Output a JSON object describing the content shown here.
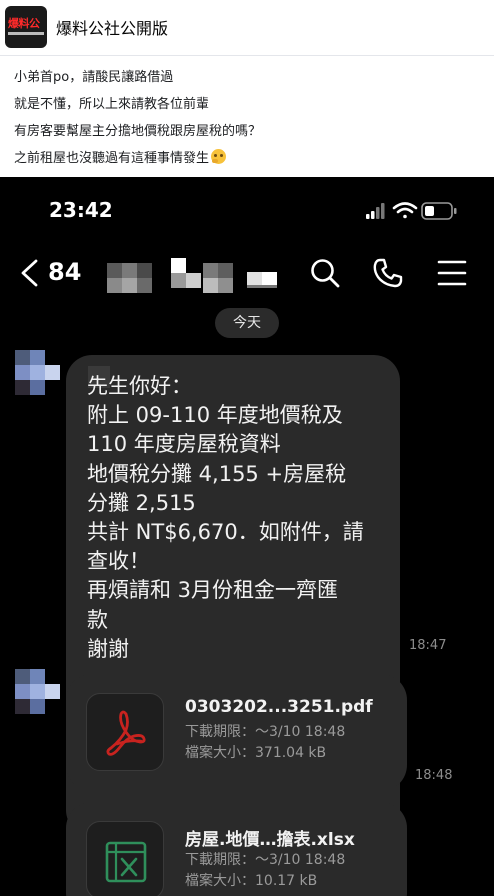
{
  "post": {
    "page_name": "爆料公社公開版",
    "avatar_text": "爆料公",
    "lines": [
      "小弟首po，請酸民讓路借過",
      "就是不懂，所以上來請教各位前輩",
      "有房客要幫屋主分擔地價稅跟房屋稅的嗎？",
      "之前租屋也沒聽過有這種事情發生"
    ]
  },
  "phone": {
    "status_time": "23:42",
    "nav": {
      "back_count": "84"
    },
    "date_chip": "今天",
    "messages": [
      {
        "text": "先生你好：\n附上 09-110 年度地價稅及\n110 年度房屋稅資料\n地價稅分攤 4,155 +房屋稅\n分攤 2,515\n共計 NT$6,670．如附件，請\n查收！\n再煩請和 3月份租金一齊匯\n款\n謝謝",
        "time": "18:47"
      }
    ],
    "files": [
      {
        "name": "0303202...3251.pdf",
        "expiry": "下載期限：～3/10 18:48",
        "size": "檔案大小：371.04 kB",
        "time": "18:48",
        "icon": "pdf-icon"
      },
      {
        "name": "房屋.地價…擔表.xlsx",
        "expiry": "下載期限：～3/10 18:48",
        "size": "檔案大小：10.17 kB",
        "icon": "excel-icon"
      }
    ]
  },
  "colors": {
    "brand_red": "#ff2a2a",
    "pdf_red": "#c8231f",
    "excel_green": "#2f8f5b"
  }
}
